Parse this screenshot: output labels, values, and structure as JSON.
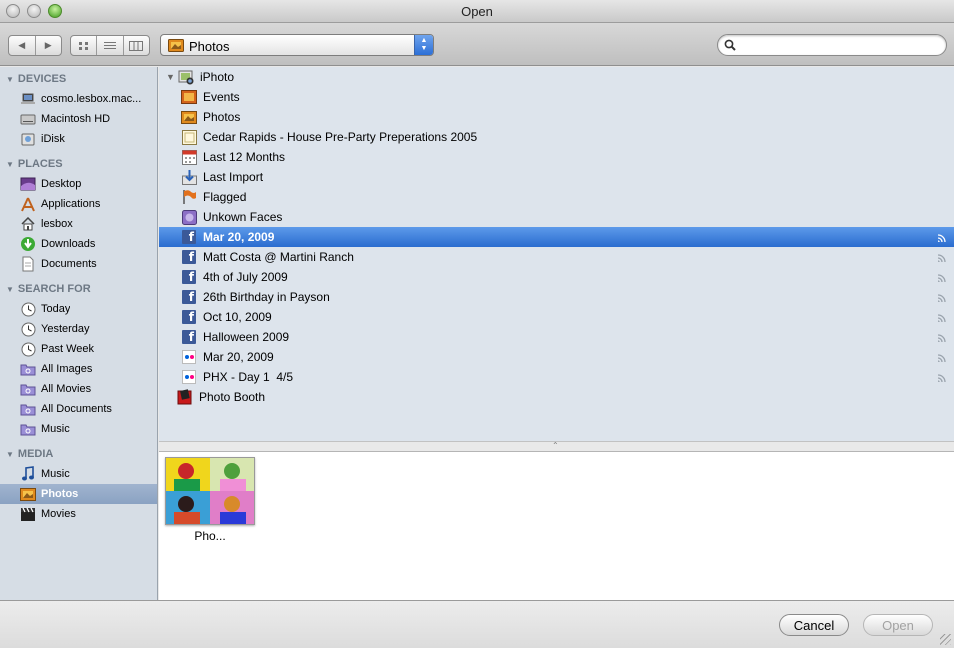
{
  "window": {
    "title": "Open"
  },
  "toolbar": {
    "back_forward": [
      "◀",
      "▶"
    ],
    "view_modes": [
      "icon-view",
      "list-view",
      "column-view"
    ],
    "location": "Photos",
    "search": {
      "value": "",
      "placeholder": ""
    }
  },
  "sidebar": {
    "sections": [
      {
        "title": "DEVICES",
        "items": [
          {
            "label": "cosmo.lesbox.mac...",
            "icon": "laptop-icon"
          },
          {
            "label": "Macintosh HD",
            "icon": "hard-drive-icon"
          },
          {
            "label": "iDisk",
            "icon": "idisk-icon"
          }
        ]
      },
      {
        "title": "PLACES",
        "items": [
          {
            "label": "Desktop",
            "icon": "desktop-icon"
          },
          {
            "label": "Applications",
            "icon": "applications-icon"
          },
          {
            "label": "lesbox",
            "icon": "home-icon"
          },
          {
            "label": "Downloads",
            "icon": "downloads-icon"
          },
          {
            "label": "Documents",
            "icon": "documents-icon"
          }
        ]
      },
      {
        "title": "SEARCH FOR",
        "items": [
          {
            "label": "Today",
            "icon": "clock-icon"
          },
          {
            "label": "Yesterday",
            "icon": "clock-icon"
          },
          {
            "label": "Past Week",
            "icon": "clock-icon"
          },
          {
            "label": "All Images",
            "icon": "smart-folder-icon"
          },
          {
            "label": "All Movies",
            "icon": "smart-folder-icon"
          },
          {
            "label": "All Documents",
            "icon": "smart-folder-icon"
          },
          {
            "label": "Music",
            "icon": "smart-folder-icon"
          }
        ]
      },
      {
        "title": "MEDIA",
        "items": [
          {
            "label": "Music",
            "icon": "music-note-icon"
          },
          {
            "label": "Photos",
            "icon": "photos-icon",
            "selected": true
          },
          {
            "label": "Movies",
            "icon": "clapper-icon"
          }
        ]
      }
    ]
  },
  "browser": {
    "root": {
      "label": "iPhoto",
      "icon": "iphoto-icon"
    },
    "items": [
      {
        "label": "Events",
        "icon": "events-icon"
      },
      {
        "label": "Photos",
        "icon": "photos-icon"
      },
      {
        "label": "Cedar Rapids - House Pre-Party Preperations 2005",
        "icon": "album-icon"
      },
      {
        "label": "Last 12 Months",
        "icon": "calendar-icon"
      },
      {
        "label": "Last Import",
        "icon": "import-icon"
      },
      {
        "label": "Flagged",
        "icon": "flag-icon"
      },
      {
        "label": "Unkown Faces",
        "icon": "faces-icon"
      },
      {
        "label": "Mar 20, 2009",
        "icon": "facebook-icon",
        "selected": true,
        "published": true
      },
      {
        "label": "Matt Costa @ Martini Ranch",
        "icon": "facebook-icon",
        "published": true
      },
      {
        "label": "4th of July 2009",
        "icon": "facebook-icon",
        "published": true
      },
      {
        "label": "26th Birthday in Payson",
        "icon": "facebook-icon",
        "published": true
      },
      {
        "label": "Oct 10, 2009",
        "icon": "facebook-icon",
        "published": true
      },
      {
        "label": "Halloween 2009",
        "icon": "facebook-icon",
        "published": true
      },
      {
        "label": "Mar 20, 2009",
        "icon": "flickr-icon",
        "published": true
      },
      {
        "label": "PHX - Day 1  4/5",
        "icon": "flickr-icon",
        "published": true
      }
    ],
    "tail": {
      "label": "Photo Booth",
      "icon": "photo-booth-icon"
    }
  },
  "preview": {
    "caption": "Pho..."
  },
  "buttons": {
    "cancel": "Cancel",
    "open": "Open"
  },
  "colors": {
    "selection": "#2a6ccf",
    "sidebar_bg": "#d6dde5",
    "browser_bg": "#dde4ec",
    "facebook": "#3b5998"
  }
}
